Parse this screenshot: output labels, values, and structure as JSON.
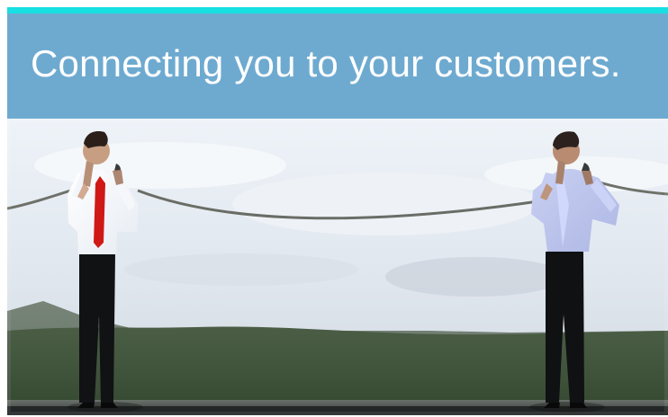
{
  "banner": {
    "headline": "Connecting you to your customers."
  },
  "colors": {
    "accent": "#17dfe2",
    "banner": "#6eaad0",
    "headline_text": "#ffffff"
  },
  "photo": {
    "subject": "two businessmen talking on phones connected by a long cord in an open field",
    "icon": "landscape-photo"
  }
}
